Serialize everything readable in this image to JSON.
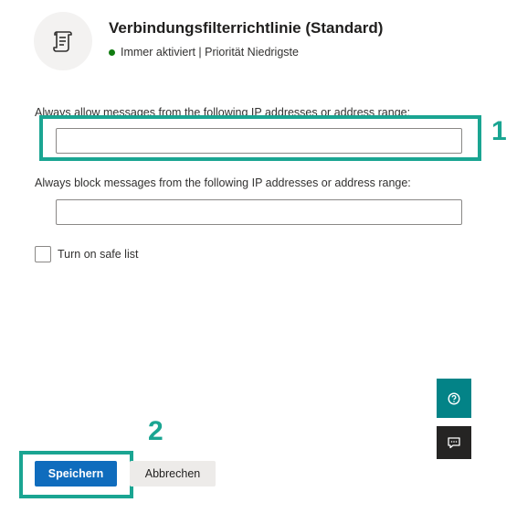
{
  "header": {
    "title": "Verbindungsfilterrichtlinie (Standard)",
    "status": "Immer aktiviert | Priorität Niedrigste",
    "status_color": "#107c10",
    "icon": "scroll-icon"
  },
  "form": {
    "allow_label": "Always allow messages from the following IP addresses or address range:",
    "allow_value": "",
    "block_label": "Always block messages from the following IP addresses or address range:",
    "block_value": "",
    "safe_list_label": "Turn on safe list",
    "safe_list_checked": false
  },
  "annotations": {
    "callout_1": "1",
    "callout_2": "2",
    "highlight_color": "#1aa592"
  },
  "side_buttons": {
    "help_icon": "help-icon",
    "feedback_icon": "feedback-icon"
  },
  "footer": {
    "save_label": "Speichern",
    "cancel_label": "Abbrechen",
    "accent_color": "#0f6cbd"
  }
}
